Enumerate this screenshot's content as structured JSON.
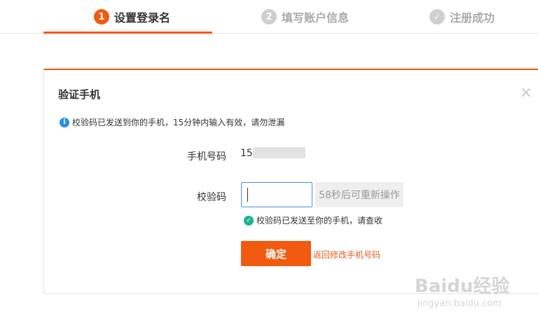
{
  "steps": [
    {
      "number": "1",
      "label": "设置登录名"
    },
    {
      "number": "2",
      "label": "填写账户信息"
    },
    {
      "number": "✓",
      "label": "注册成功"
    }
  ],
  "dialog": {
    "title": "验证手机",
    "close_icon": "×",
    "notice": "校验码已发送到你的手机，15分钟内输入有效，请勿泄漏",
    "phone_label": "手机号码",
    "phone_value": "15",
    "code_label": "校验码",
    "code_value": "",
    "resend_label": "58秒后可重新操作",
    "sent_note": "校验码已发送至你的手机，请查收",
    "confirm_label": "确定",
    "back_link": "返回修改手机号码"
  },
  "watermark": {
    "logo": "Baidu经验",
    "sub": "jingyan.baidu.com"
  },
  "colors": {
    "accent": "#f25a0f",
    "info": "#2b8ce8",
    "success": "#1ab394",
    "input_border": "#4a90e2"
  },
  "icons": {
    "info": "info-icon",
    "check": "check-circle-icon",
    "close": "close-icon"
  }
}
